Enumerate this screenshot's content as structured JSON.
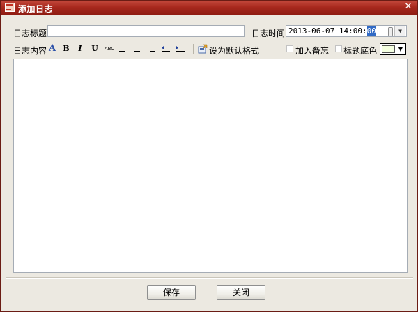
{
  "window": {
    "title": "添加日志",
    "accent_color": "#a8291e"
  },
  "form": {
    "title_label": "日志标题",
    "title_value": "",
    "time_label": "日志时间",
    "time_value_main": "2013-06-07 14:00:",
    "time_value_selected": "00",
    "content_label": "日志内容"
  },
  "toolbar": {
    "font_color": "A",
    "bold": "B",
    "italic": "I",
    "underline": "U",
    "strikethrough": "ABC",
    "set_default_format": "设为默认格式"
  },
  "options": {
    "add_memo": "加入备忘",
    "add_memo_checked": false,
    "title_bg": "标题底色",
    "title_bg_checked": false,
    "title_bg_color": "#f4ffe0"
  },
  "buttons": {
    "save": "保存",
    "close": "关闭"
  }
}
